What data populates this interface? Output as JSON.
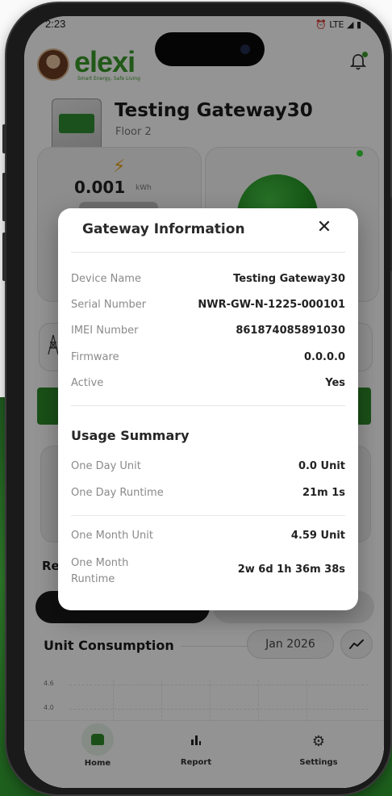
{
  "status_bar": {
    "time": "2:23",
    "icons": "⏰ LTE ◢ ▮"
  },
  "app": {
    "brand": "elexi",
    "brand_tagline": "Smart Energy, Safe Living",
    "gateway_title": "Testing Gateway30",
    "gateway_floor": "Floor 2",
    "energy_value": "0.001",
    "energy_unit": "kWh",
    "section_partial": "Re",
    "unit_consumption_title": "Unit Consumption",
    "month_selector": "Jan 2026",
    "chart_ticks": [
      "4.6",
      "4.0"
    ]
  },
  "tabs": [
    {
      "label": "Home"
    },
    {
      "label": "Report"
    },
    {
      "label": "Settings"
    }
  ],
  "modal": {
    "title": "Gateway Information",
    "close_glyph": "✕",
    "gateway_rows": [
      {
        "label": "Device Name",
        "value": "Testing Gateway30"
      },
      {
        "label": "Serial Number",
        "value": "NWR-GW-N-1225-000101"
      },
      {
        "label": "IMEI Number",
        "value": "861874085891030"
      },
      {
        "label": "Firmware",
        "value": "0.0.0.0"
      },
      {
        "label": "Active",
        "value": "Yes"
      }
    ],
    "usage_title": "Usage Summary",
    "usage_rows": [
      {
        "label": "One Day Unit",
        "value": "0.0 Unit"
      },
      {
        "label": "One Day Runtime",
        "value": "21m 1s"
      },
      {
        "label": "One Month Unit",
        "value": "4.59 Unit"
      },
      {
        "label": "One Month Runtime",
        "value": "2w 6d 1h 36m 38s"
      }
    ]
  },
  "colors": {
    "brand_green": "#3a9a2a",
    "active_indicator": "#3ad43a",
    "backdrop_green": "#2e7d2a"
  }
}
